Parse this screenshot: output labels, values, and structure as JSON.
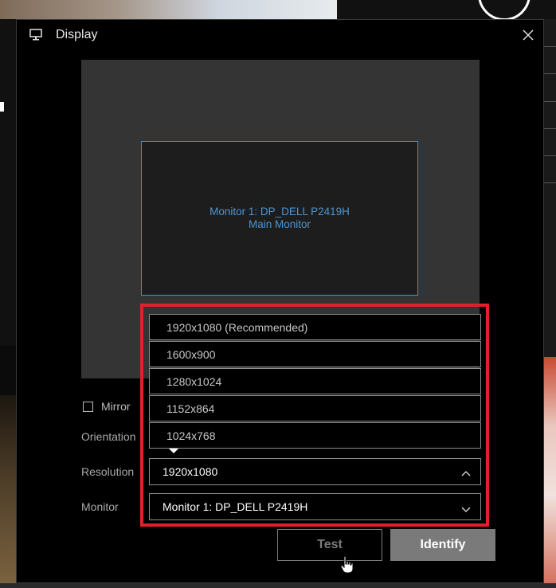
{
  "dialog": {
    "title": "Display",
    "icon": "monitor-icon",
    "close_icon": "close-icon"
  },
  "preview": {
    "monitor_name": "Monitor 1: DP_DELL P2419H",
    "monitor_role": "Main Monitor"
  },
  "mirror": {
    "label": "Mirror",
    "checked": false
  },
  "labels": {
    "orientation": "Orientation",
    "resolution": "Resolution",
    "monitor": "Monitor"
  },
  "resolution_options": [
    "1920x1080 (Recommended)",
    "1600x900",
    "1280x1024",
    "1152x864",
    "1024x768"
  ],
  "resolution_selected": "1920x1080",
  "monitor_selected": "Monitor 1: DP_DELL P2419H",
  "buttons": {
    "test": "Test",
    "identify": "Identify"
  },
  "colors": {
    "highlight": "#e0202a",
    "monitor_accent": "#4f95cf"
  }
}
